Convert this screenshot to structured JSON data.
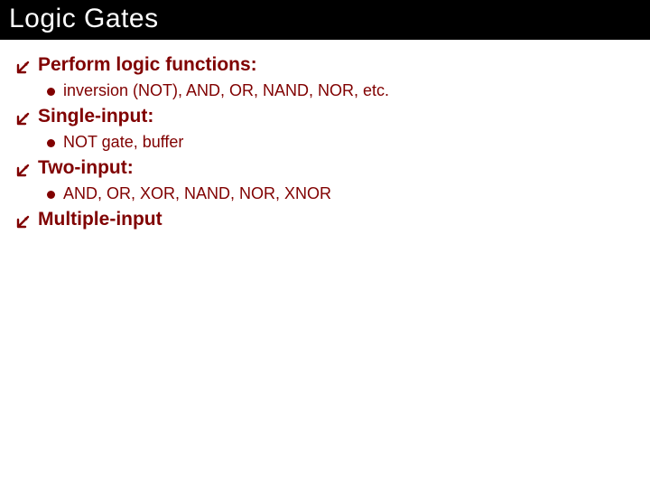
{
  "title": "Logic Gates",
  "items": [
    {
      "label": "Perform logic functions:",
      "sub": [
        {
          "label": "inversion (NOT), AND, OR, NAND, NOR, etc."
        }
      ]
    },
    {
      "label": "Single-input:",
      "sub": [
        {
          "label": "NOT gate, buffer"
        }
      ]
    },
    {
      "label": "Two-input:",
      "sub": [
        {
          "label": "AND, OR, XOR, NAND, NOR, XNOR"
        }
      ]
    },
    {
      "label": "Multiple-input",
      "sub": []
    }
  ],
  "colors": {
    "accent": "#800000",
    "title_bg": "#000000",
    "title_fg": "#ffffff",
    "slide_bg": "#ffffff"
  }
}
